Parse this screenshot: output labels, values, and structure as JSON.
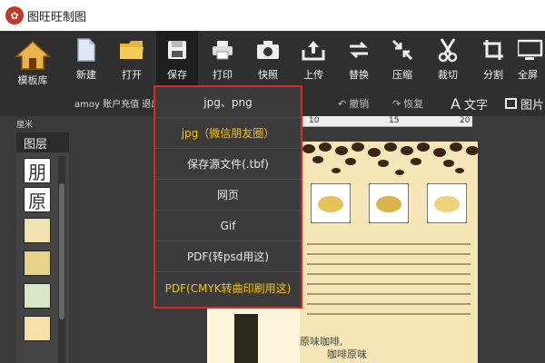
{
  "app": {
    "title": "图旺旺制图"
  },
  "toolbar": {
    "template_label": "模板库",
    "tools": [
      {
        "id": "new",
        "label": "新建",
        "icon": "new-file-icon"
      },
      {
        "id": "open",
        "label": "打开",
        "icon": "folder-icon"
      },
      {
        "id": "save",
        "label": "保存",
        "icon": "save-icon"
      },
      {
        "id": "print",
        "label": "打印",
        "icon": "printer-icon"
      },
      {
        "id": "snapshot",
        "label": "快照",
        "icon": "camera-icon"
      },
      {
        "id": "upload",
        "label": "上传",
        "icon": "upload-icon"
      },
      {
        "id": "replace",
        "label": "替换",
        "icon": "swap-icon"
      },
      {
        "id": "compress",
        "label": "压缩",
        "icon": "compress-icon"
      },
      {
        "id": "cut",
        "label": "裁切",
        "icon": "scissors-icon"
      },
      {
        "id": "split",
        "label": "分割",
        "icon": "crop-icon"
      },
      {
        "id": "fullscreen",
        "label": "全屏",
        "icon": "monitor-icon"
      }
    ]
  },
  "subbar": {
    "account": "amoy 账户充值 退出",
    "undo": "撤销",
    "redo": "恢复",
    "text": "文字",
    "image": "图片"
  },
  "ruler": {
    "unit": "厘米",
    "ticks": [
      "10",
      "15",
      "20"
    ]
  },
  "layers": {
    "title": "图层",
    "items": [
      "朋",
      "原"
    ]
  },
  "canvas": {
    "poem_line1": "原味咖啡,",
    "poem_line2": "咖啡原味"
  },
  "save_menu": {
    "items": [
      {
        "label": "jpg、png",
        "highlight": false
      },
      {
        "label": "jpg（微信朋友圈）",
        "highlight": true
      },
      {
        "label": "保存源文件(.tbf)",
        "highlight": false
      },
      {
        "label": "网页",
        "highlight": false
      },
      {
        "label": "Gif",
        "highlight": false
      },
      {
        "label": "PDF(转psd用这)",
        "highlight": false
      },
      {
        "label": "PDF(CMYK转曲印刷用这)",
        "highlight": true
      }
    ]
  },
  "colors": {
    "menu_border": "#e0281f",
    "highlight": "#f6c30a",
    "toolbar": "#2f2f2f"
  }
}
